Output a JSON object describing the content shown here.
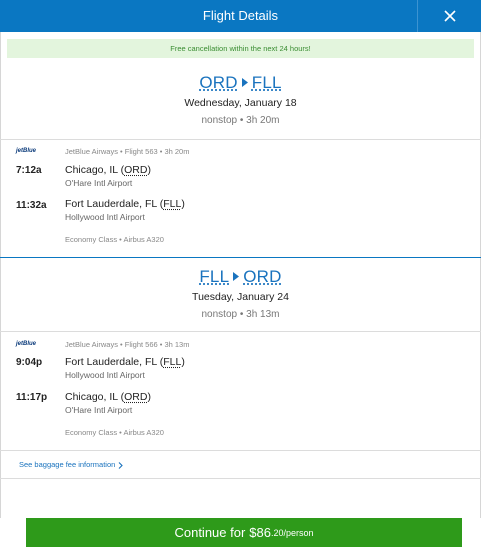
{
  "header": {
    "title": "Flight Details"
  },
  "banner": {
    "text": "Free cancellation within the next 24 hours!"
  },
  "outbound": {
    "from": "ORD",
    "to": "FLL",
    "date": "Wednesday, January 18",
    "meta": "nonstop • 3h 20m",
    "airline_logo": "jetBlue",
    "airline_line": "JetBlue Airways • Flight 563 • 3h 20m",
    "depart": {
      "time": "7:12a",
      "city": "Chicago, IL (",
      "code": "ORD",
      "close": ")",
      "airport": "O'Hare Intl Airport"
    },
    "arrive": {
      "time": "11:32a",
      "city": "Fort Lauderdale, FL (",
      "code": "FLL",
      "close": ")",
      "airport": "Hollywood Intl Airport"
    },
    "class_line": "Economy Class • Airbus A320"
  },
  "return": {
    "from": "FLL",
    "to": "ORD",
    "date": "Tuesday, January 24",
    "meta": "nonstop • 3h 13m",
    "airline_logo": "jetBlue",
    "airline_line": "JetBlue Airways • Flight 566 • 3h 13m",
    "depart": {
      "time": "9:04p",
      "city": "Fort Lauderdale, FL (",
      "code": "FLL",
      "close": ")",
      "airport": "Hollywood Intl Airport"
    },
    "arrive": {
      "time": "11:17p",
      "city": "Chicago, IL (",
      "code": "ORD",
      "close": ")",
      "airport": "O'Hare Intl Airport"
    },
    "class_line": "Economy Class • Airbus A320"
  },
  "baggage": {
    "link": "See baggage fee information"
  },
  "continue": {
    "label": "Continue for",
    "price_main": "$86",
    "price_cents": ".20/person"
  },
  "colors": {
    "header": "#0a77c2",
    "link": "#1a73be",
    "button": "#2e9a1a",
    "banner_bg": "#e3f5dd",
    "banner_text": "#3a8d32"
  }
}
